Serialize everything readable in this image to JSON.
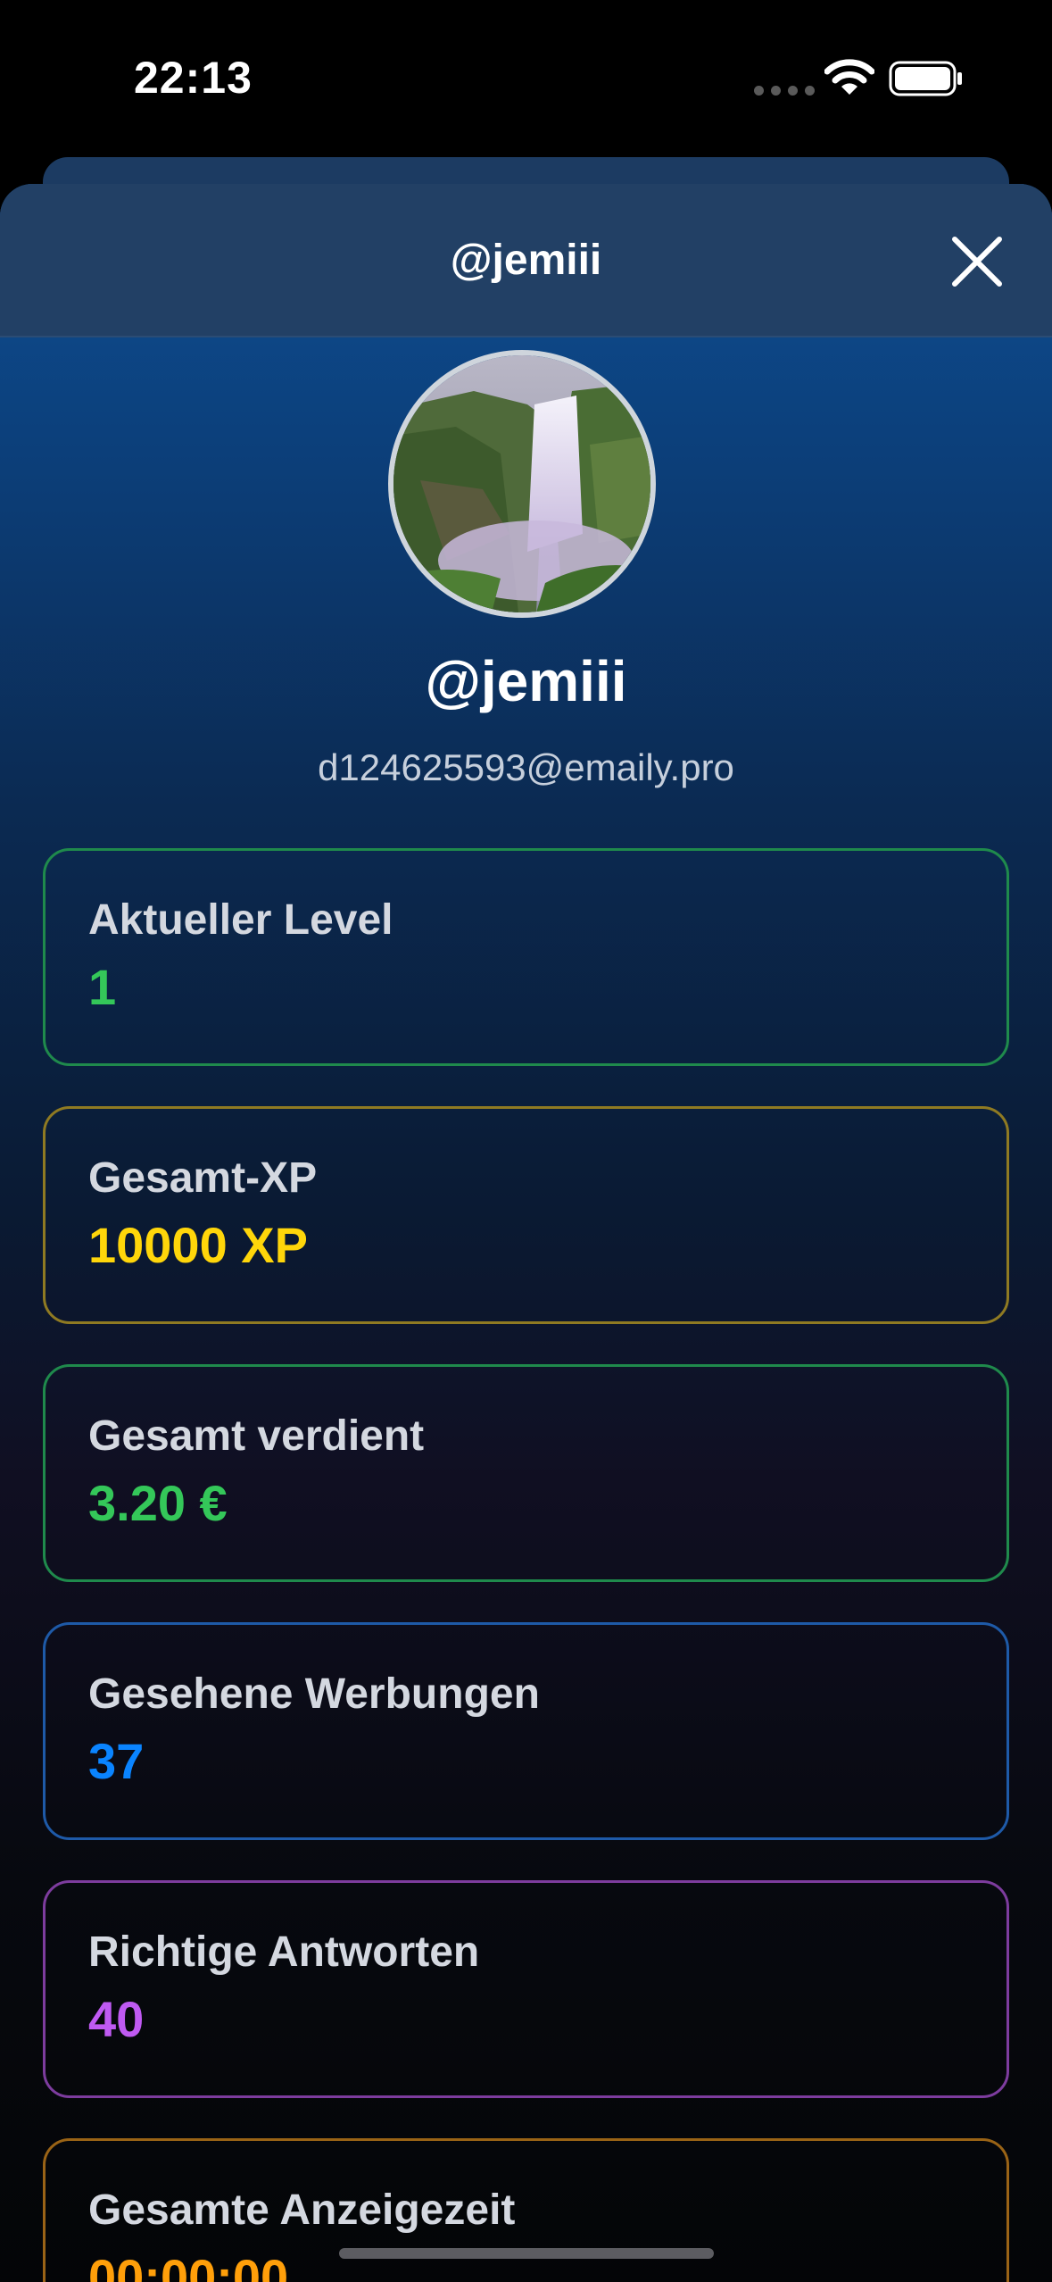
{
  "status_bar": {
    "time": "22:13"
  },
  "header": {
    "title": "@jemiii"
  },
  "profile": {
    "username": "@jemiii",
    "email": "d124625593@emaily.pro"
  },
  "stats": [
    {
      "label": "Aktueller Level",
      "value": "1",
      "color": "#34c759",
      "border": "#1f8a4c"
    },
    {
      "label": "Gesamt-XP",
      "value": "10000 XP",
      "color": "#ffd60a",
      "border": "#8f7a22"
    },
    {
      "label": "Gesamt verdient",
      "value": "3.20 €",
      "color": "#34c759",
      "border": "#1f8a4c"
    },
    {
      "label": "Gesehene Werbungen",
      "value": "37",
      "color": "#0a84ff",
      "border": "#1e5aa8"
    },
    {
      "label": "Richtige Antworten",
      "value": "40",
      "color": "#bf5af2",
      "border": "#7d3c9e"
    },
    {
      "label": "Gesamte Anzeigezeit",
      "value": "00:00:00",
      "color": "#ff9f0a",
      "border": "#9a6316"
    }
  ]
}
